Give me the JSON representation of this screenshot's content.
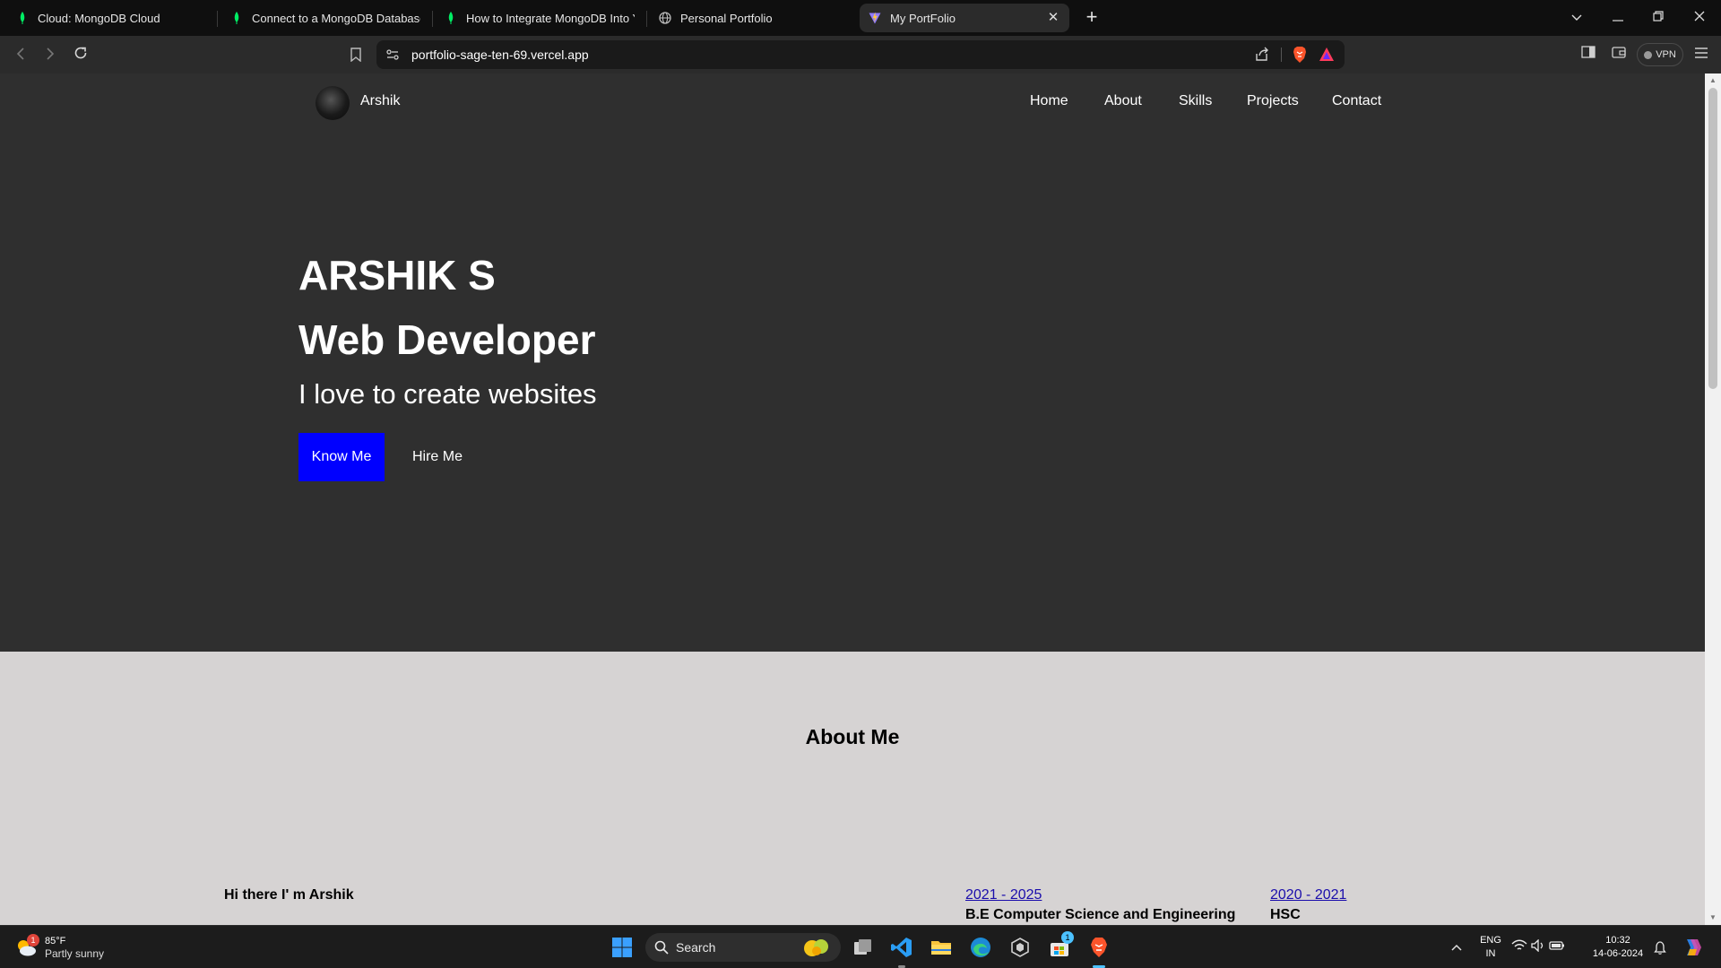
{
  "browser": {
    "tabs": [
      {
        "title": "Cloud: MongoDB Cloud",
        "icon": "mongodb-leaf-icon",
        "active": false
      },
      {
        "title": "Connect to a MongoDB Database Us",
        "icon": "mongodb-leaf-icon",
        "active": false
      },
      {
        "title": "How to Integrate MongoDB Into You",
        "icon": "mongodb-leaf-icon",
        "active": false
      },
      {
        "title": "Personal Portfolio",
        "icon": "globe-icon",
        "active": false
      },
      {
        "title": "My PortFolio",
        "icon": "vite-icon",
        "active": true
      }
    ],
    "url": "portfolio-sage-ten-69.vercel.app",
    "vpn_label": "VPN",
    "colors": {
      "tabbar": "#0f0f0f",
      "toolbar": "#2b2b2b",
      "mongo_green": "#00ed64"
    }
  },
  "site": {
    "nav": {
      "brand": "Arshik",
      "links": [
        "Home",
        "About",
        "Skills",
        "Projects",
        "Contact"
      ]
    },
    "hero": {
      "name": "ARSHIK S",
      "role": "Web Developer",
      "tagline": "I love to create websites",
      "primary_button": "Know Me",
      "secondary_button": "Hire Me",
      "colors": {
        "background": "#2f2f2f",
        "primary_button": "#0000ff"
      }
    },
    "about": {
      "title": "About Me",
      "intro": "Hi there I' m Arshik",
      "education": [
        {
          "period": "2021 - 2025",
          "degree": "B.E Computer Science and Engineering"
        },
        {
          "period": "2020 - 2021",
          "degree": "HSC"
        }
      ],
      "colors": {
        "background": "#d6d3d3",
        "link": "#1a0dab"
      }
    }
  },
  "taskbar": {
    "weather": {
      "temp": "85°F",
      "condition": "Partly sunny",
      "badge": "1"
    },
    "search_label": "Search",
    "store_badge": "1",
    "language": {
      "line1": "ENG",
      "line2": "IN"
    },
    "clock": {
      "time": "10:32",
      "date": "14-06-2024"
    }
  }
}
